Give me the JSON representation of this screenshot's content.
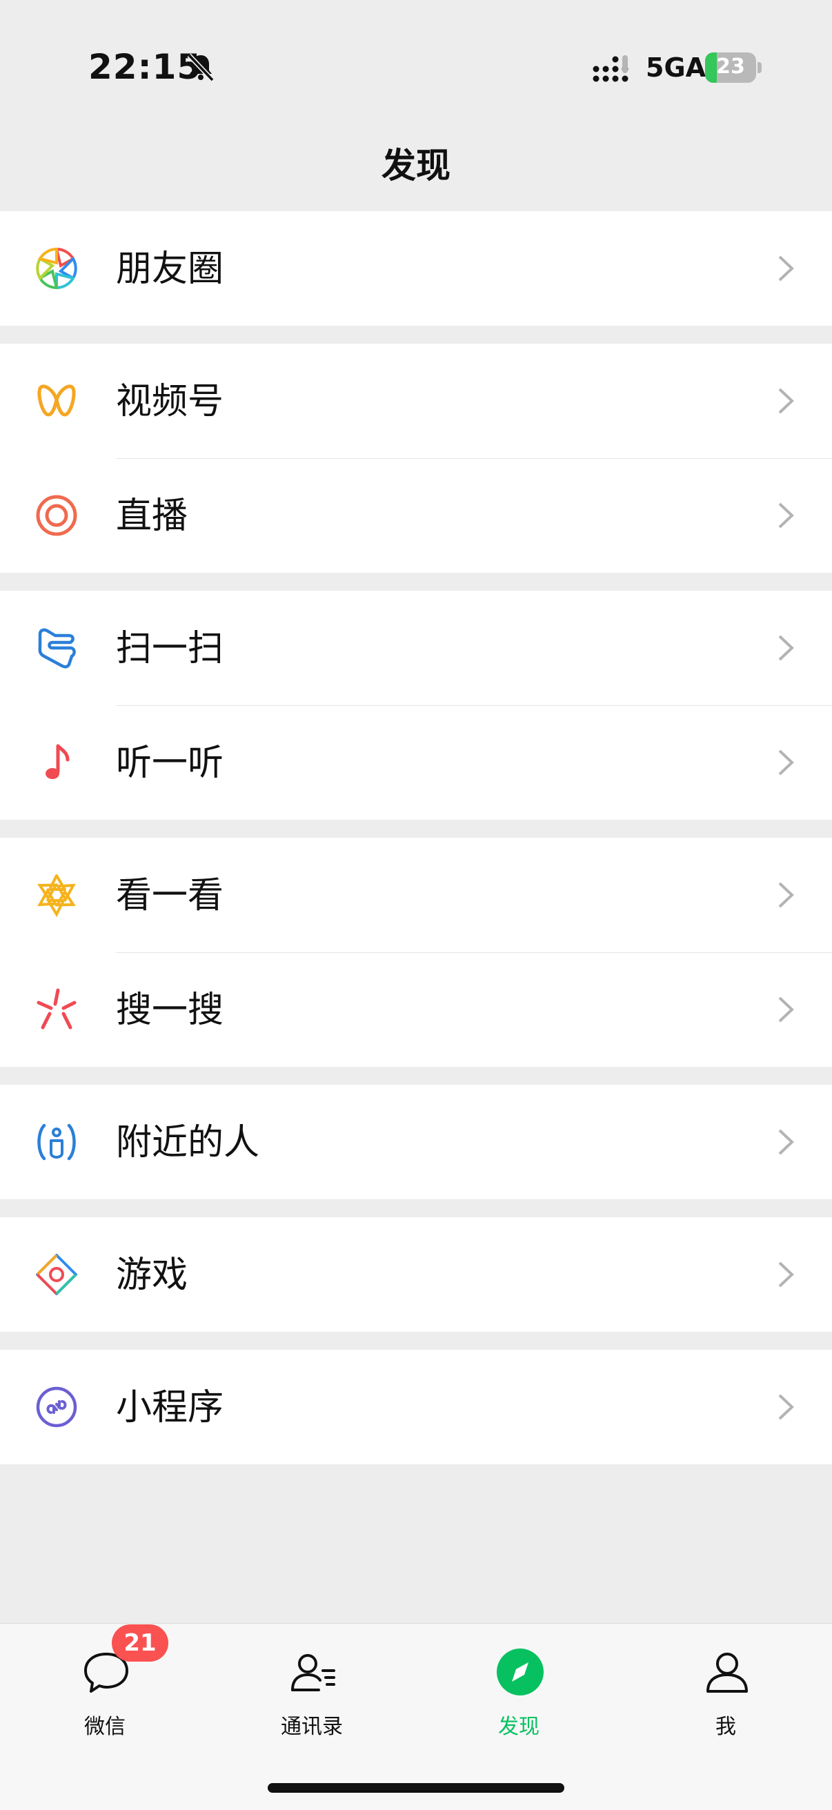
{
  "status_bar": {
    "time": "22:15",
    "network": "5GA",
    "battery": "23",
    "battery_level": 0.23
  },
  "header": {
    "title": "发现"
  },
  "menu": {
    "groups": [
      {
        "items": [
          {
            "label": "朋友圈",
            "icon": "moments-icon"
          }
        ]
      },
      {
        "items": [
          {
            "label": "视频号",
            "icon": "channels-icon"
          },
          {
            "label": "直播",
            "icon": "live-icon"
          }
        ]
      },
      {
        "items": [
          {
            "label": "扫一扫",
            "icon": "scan-icon"
          },
          {
            "label": "听一听",
            "icon": "music-note-icon"
          }
        ]
      },
      {
        "items": [
          {
            "label": "看一看",
            "icon": "top-stories-icon"
          },
          {
            "label": "搜一搜",
            "icon": "search-sparkle-icon"
          }
        ]
      },
      {
        "items": [
          {
            "label": "附近的人",
            "icon": "people-nearby-icon"
          }
        ]
      },
      {
        "items": [
          {
            "label": "游戏",
            "icon": "games-icon"
          }
        ]
      },
      {
        "items": [
          {
            "label": "小程序",
            "icon": "mini-programs-icon"
          }
        ]
      }
    ]
  },
  "tab_bar": {
    "tabs": [
      {
        "label": "微信",
        "icon": "chat-bubble-icon",
        "badge": "21",
        "active": false
      },
      {
        "label": "通讯录",
        "icon": "contacts-icon",
        "active": false
      },
      {
        "label": "发现",
        "icon": "discover-compass-icon",
        "active": true
      },
      {
        "label": "我",
        "icon": "me-person-icon",
        "active": false
      }
    ]
  },
  "colors": {
    "accent": "#07c160",
    "badge": "#fa5151",
    "background": "#ededed"
  }
}
